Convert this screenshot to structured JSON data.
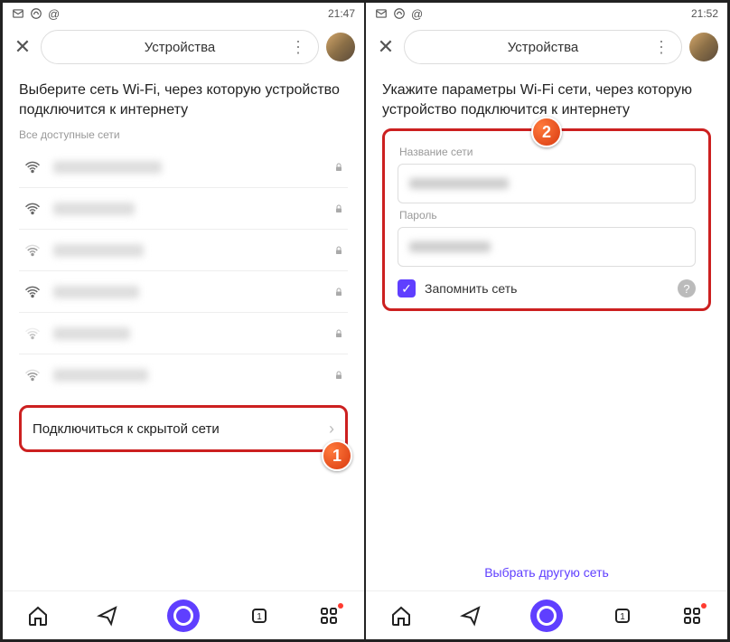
{
  "left": {
    "status": {
      "time": "21:47"
    },
    "header": {
      "title": "Устройства"
    },
    "heading": "Выберите сеть Wi-Fi, через которую устройство подключится к интернету",
    "subheading": "Все доступные сети",
    "wifi_items": [
      {
        "signal": 4,
        "locked": true
      },
      {
        "signal": 4,
        "locked": true
      },
      {
        "signal": 3,
        "locked": true
      },
      {
        "signal": 4,
        "locked": true
      },
      {
        "signal": 2,
        "locked": true
      },
      {
        "signal": 3,
        "locked": true
      }
    ],
    "hidden_network_label": "Подключиться к скрытой сети",
    "badge": "1"
  },
  "right": {
    "status": {
      "time": "21:52"
    },
    "header": {
      "title": "Устройства"
    },
    "heading": "Укажите параметры Wi-Fi сети, через которую устройство подключится к интернету",
    "form": {
      "network_label": "Название сети",
      "password_label": "Пароль",
      "remember_label": "Запомнить сеть"
    },
    "other_network_link": "Выбрать другую сеть",
    "badge": "2"
  }
}
